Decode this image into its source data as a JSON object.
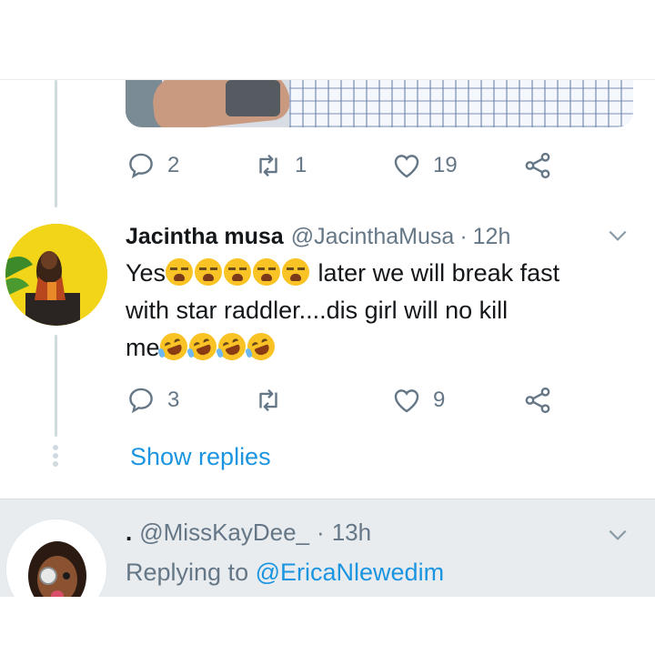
{
  "top_tweet": {
    "actions": {
      "reply_count": "2",
      "retweet_count": "1",
      "like_count": "19"
    }
  },
  "reply_tweet": {
    "display_name": "Jacintha musa",
    "handle": "@JacinthaMusa",
    "separator": "·",
    "time": "12h",
    "text": {
      "line1_prefix": "Yes",
      "line1_suffix": " later we will break fast",
      "line2": "with star raddler....dis girl will no kill",
      "line3_prefix": "me"
    },
    "emoji": {
      "sob_count": 5,
      "laugh_count": 4
    },
    "actions": {
      "reply_count": "3",
      "retweet_count": "",
      "like_count": "9"
    },
    "show_replies_label": "Show replies"
  },
  "next_tweet": {
    "display_name": ".",
    "handle": "@MissKayDee_",
    "separator": "·",
    "time": "13h",
    "replying_prefix": "Replying to",
    "replying_mention": "@EricaNlewedim"
  },
  "colors": {
    "accent": "#1b95e0",
    "muted": "#657786",
    "text": "#14171a",
    "avatar_bg": "#f2d418",
    "section_bg": "#e8ecef"
  },
  "icons": [
    "reply-icon",
    "retweet-icon",
    "like-icon",
    "share-icon",
    "chevron-down-icon"
  ]
}
